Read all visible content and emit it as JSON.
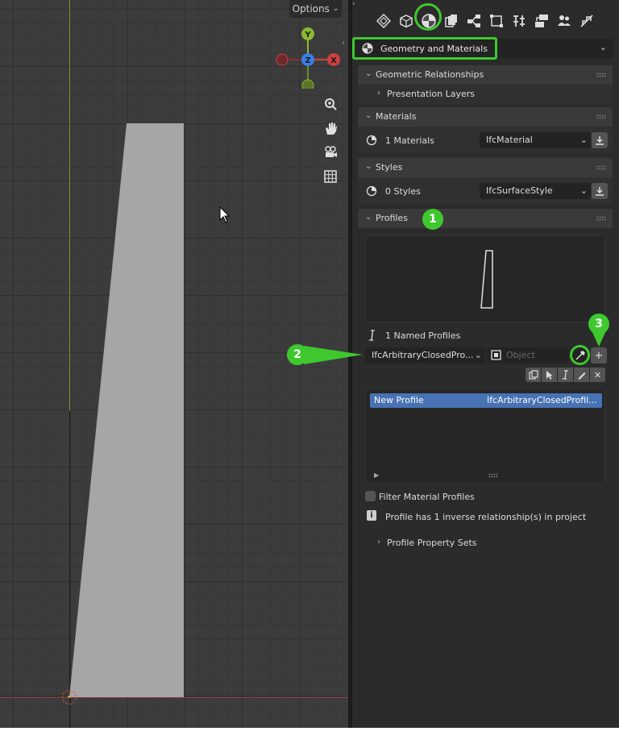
{
  "viewport": {
    "options_label": "Options",
    "gizmo": {
      "y": "Y",
      "z": "Z",
      "x": "X"
    },
    "nav_icons": [
      "zoom-icon",
      "hand-pan-icon",
      "camera-icon",
      "grid-icon"
    ]
  },
  "properties": {
    "tabs": [
      "tool-icon",
      "object-icon",
      "geometry-materials-icon",
      "layers-icon",
      "network-icon",
      "bounding-icon",
      "structure-icon",
      "stack-icon",
      "users-icon",
      "link-icon"
    ],
    "context_select": "Geometry and Materials",
    "panels": {
      "geometric_relationships": {
        "title": "Geometric Relationships",
        "presentation_layers": "Presentation Layers"
      },
      "materials": {
        "title": "Materials",
        "count_label": "1 Materials",
        "type": "IfcMaterial"
      },
      "styles": {
        "title": "Styles",
        "count_label": "0 Styles",
        "type": "IfcSurfaceStyle"
      },
      "profiles": {
        "title": "Profiles",
        "named_profiles": "1 Named Profiles",
        "profile_type": "IfcArbitraryClosedPro...",
        "object_placeholder": "Object",
        "list": [
          {
            "name": "New Profile",
            "type": "IfcArbitraryClosedProfil..."
          }
        ],
        "filter_label": "Filter Material Profiles",
        "info_text": "Profile has 1 inverse relationship(s) in project",
        "property_sets": "Profile Property Sets"
      }
    }
  },
  "annotations": {
    "badge1": "1",
    "badge2": "2",
    "badge3": "3"
  },
  "colors": {
    "highlight": "#3ec82e",
    "selection": "#4772b3",
    "panel_bg": "#2b2b2b"
  }
}
